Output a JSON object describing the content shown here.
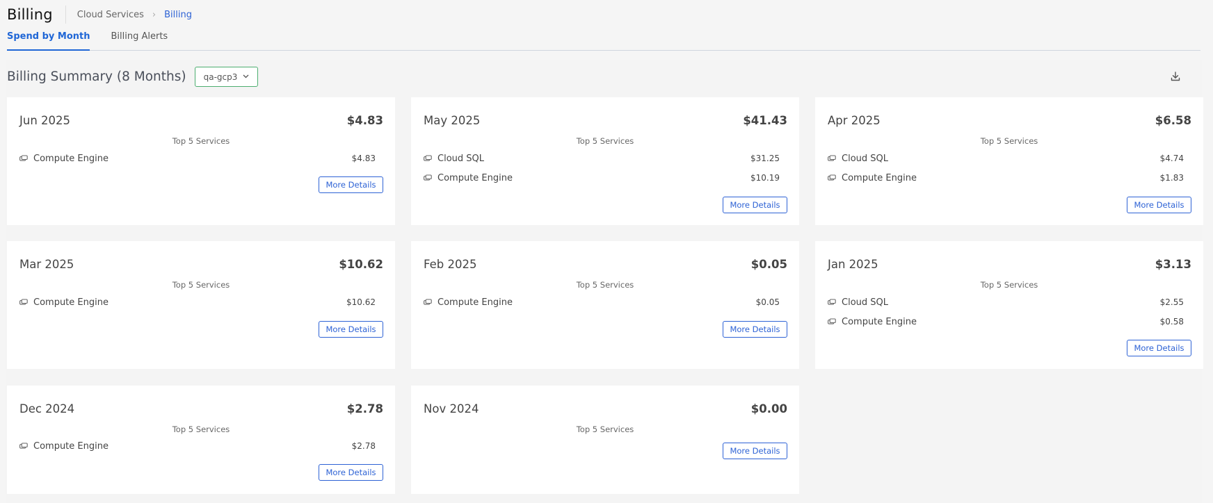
{
  "header": {
    "title": "Billing",
    "breadcrumb": [
      "Cloud Services",
      "Billing"
    ],
    "breadcrumb_separator": "›"
  },
  "tabs": [
    {
      "label": "Spend by Month",
      "active": true
    },
    {
      "label": "Billing Alerts",
      "active": false
    }
  ],
  "summary": {
    "title": "Billing Summary (8 Months)",
    "account_selected": "qa-gcp3",
    "download_icon": "download-icon"
  },
  "colors": {
    "accent": "#1f66d6",
    "select_border": "#4cae70"
  },
  "cards": [
    {
      "month": "Jun 2025",
      "total": "$4.83",
      "subtitle": "Top 5 Services",
      "button": "More Details",
      "services": [
        {
          "name": "Compute Engine",
          "cost": "$4.83"
        }
      ]
    },
    {
      "month": "May 2025",
      "total": "$41.43",
      "subtitle": "Top 5 Services",
      "button": "More Details",
      "services": [
        {
          "name": "Cloud SQL",
          "cost": "$31.25"
        },
        {
          "name": "Compute Engine",
          "cost": "$10.19"
        }
      ]
    },
    {
      "month": "Apr 2025",
      "total": "$6.58",
      "subtitle": "Top 5 Services",
      "button": "More Details",
      "services": [
        {
          "name": "Cloud SQL",
          "cost": "$4.74"
        },
        {
          "name": "Compute Engine",
          "cost": "$1.83"
        }
      ]
    },
    {
      "month": "Mar 2025",
      "total": "$10.62",
      "subtitle": "Top 5 Services",
      "button": "More Details",
      "services": [
        {
          "name": "Compute Engine",
          "cost": "$10.62"
        }
      ]
    },
    {
      "month": "Feb 2025",
      "total": "$0.05",
      "subtitle": "Top 5 Services",
      "button": "More Details",
      "services": [
        {
          "name": "Compute Engine",
          "cost": "$0.05"
        }
      ]
    },
    {
      "month": "Jan 2025",
      "total": "$3.13",
      "subtitle": "Top 5 Services",
      "button": "More Details",
      "services": [
        {
          "name": "Cloud SQL",
          "cost": "$2.55"
        },
        {
          "name": "Compute Engine",
          "cost": "$0.58"
        }
      ]
    },
    {
      "month": "Dec 2024",
      "total": "$2.78",
      "subtitle": "Top 5 Services",
      "button": "More Details",
      "services": [
        {
          "name": "Compute Engine",
          "cost": "$2.78"
        }
      ]
    },
    {
      "month": "Nov 2024",
      "total": "$0.00",
      "subtitle": "Top 5 Services",
      "button": "More Details",
      "services": []
    }
  ]
}
